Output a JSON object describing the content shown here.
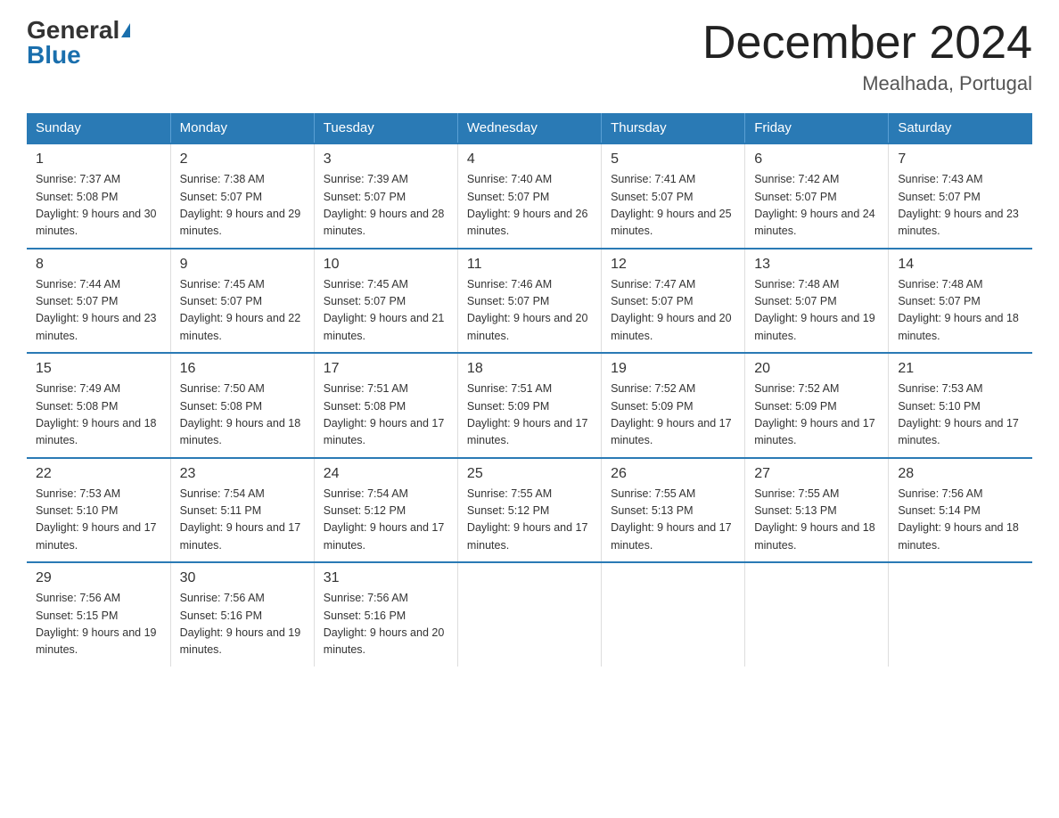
{
  "header": {
    "logo_general": "General",
    "logo_blue": "Blue",
    "title": "December 2024",
    "location": "Mealhada, Portugal"
  },
  "columns": [
    "Sunday",
    "Monday",
    "Tuesday",
    "Wednesday",
    "Thursday",
    "Friday",
    "Saturday"
  ],
  "weeks": [
    [
      {
        "day": "1",
        "sunrise": "7:37 AM",
        "sunset": "5:08 PM",
        "daylight": "9 hours and 30 minutes."
      },
      {
        "day": "2",
        "sunrise": "7:38 AM",
        "sunset": "5:07 PM",
        "daylight": "9 hours and 29 minutes."
      },
      {
        "day": "3",
        "sunrise": "7:39 AM",
        "sunset": "5:07 PM",
        "daylight": "9 hours and 28 minutes."
      },
      {
        "day": "4",
        "sunrise": "7:40 AM",
        "sunset": "5:07 PM",
        "daylight": "9 hours and 26 minutes."
      },
      {
        "day": "5",
        "sunrise": "7:41 AM",
        "sunset": "5:07 PM",
        "daylight": "9 hours and 25 minutes."
      },
      {
        "day": "6",
        "sunrise": "7:42 AM",
        "sunset": "5:07 PM",
        "daylight": "9 hours and 24 minutes."
      },
      {
        "day": "7",
        "sunrise": "7:43 AM",
        "sunset": "5:07 PM",
        "daylight": "9 hours and 23 minutes."
      }
    ],
    [
      {
        "day": "8",
        "sunrise": "7:44 AM",
        "sunset": "5:07 PM",
        "daylight": "9 hours and 23 minutes."
      },
      {
        "day": "9",
        "sunrise": "7:45 AM",
        "sunset": "5:07 PM",
        "daylight": "9 hours and 22 minutes."
      },
      {
        "day": "10",
        "sunrise": "7:45 AM",
        "sunset": "5:07 PM",
        "daylight": "9 hours and 21 minutes."
      },
      {
        "day": "11",
        "sunrise": "7:46 AM",
        "sunset": "5:07 PM",
        "daylight": "9 hours and 20 minutes."
      },
      {
        "day": "12",
        "sunrise": "7:47 AM",
        "sunset": "5:07 PM",
        "daylight": "9 hours and 20 minutes."
      },
      {
        "day": "13",
        "sunrise": "7:48 AM",
        "sunset": "5:07 PM",
        "daylight": "9 hours and 19 minutes."
      },
      {
        "day": "14",
        "sunrise": "7:48 AM",
        "sunset": "5:07 PM",
        "daylight": "9 hours and 18 minutes."
      }
    ],
    [
      {
        "day": "15",
        "sunrise": "7:49 AM",
        "sunset": "5:08 PM",
        "daylight": "9 hours and 18 minutes."
      },
      {
        "day": "16",
        "sunrise": "7:50 AM",
        "sunset": "5:08 PM",
        "daylight": "9 hours and 18 minutes."
      },
      {
        "day": "17",
        "sunrise": "7:51 AM",
        "sunset": "5:08 PM",
        "daylight": "9 hours and 17 minutes."
      },
      {
        "day": "18",
        "sunrise": "7:51 AM",
        "sunset": "5:09 PM",
        "daylight": "9 hours and 17 minutes."
      },
      {
        "day": "19",
        "sunrise": "7:52 AM",
        "sunset": "5:09 PM",
        "daylight": "9 hours and 17 minutes."
      },
      {
        "day": "20",
        "sunrise": "7:52 AM",
        "sunset": "5:09 PM",
        "daylight": "9 hours and 17 minutes."
      },
      {
        "day": "21",
        "sunrise": "7:53 AM",
        "sunset": "5:10 PM",
        "daylight": "9 hours and 17 minutes."
      }
    ],
    [
      {
        "day": "22",
        "sunrise": "7:53 AM",
        "sunset": "5:10 PM",
        "daylight": "9 hours and 17 minutes."
      },
      {
        "day": "23",
        "sunrise": "7:54 AM",
        "sunset": "5:11 PM",
        "daylight": "9 hours and 17 minutes."
      },
      {
        "day": "24",
        "sunrise": "7:54 AM",
        "sunset": "5:12 PM",
        "daylight": "9 hours and 17 minutes."
      },
      {
        "day": "25",
        "sunrise": "7:55 AM",
        "sunset": "5:12 PM",
        "daylight": "9 hours and 17 minutes."
      },
      {
        "day": "26",
        "sunrise": "7:55 AM",
        "sunset": "5:13 PM",
        "daylight": "9 hours and 17 minutes."
      },
      {
        "day": "27",
        "sunrise": "7:55 AM",
        "sunset": "5:13 PM",
        "daylight": "9 hours and 18 minutes."
      },
      {
        "day": "28",
        "sunrise": "7:56 AM",
        "sunset": "5:14 PM",
        "daylight": "9 hours and 18 minutes."
      }
    ],
    [
      {
        "day": "29",
        "sunrise": "7:56 AM",
        "sunset": "5:15 PM",
        "daylight": "9 hours and 19 minutes."
      },
      {
        "day": "30",
        "sunrise": "7:56 AM",
        "sunset": "5:16 PM",
        "daylight": "9 hours and 19 minutes."
      },
      {
        "day": "31",
        "sunrise": "7:56 AM",
        "sunset": "5:16 PM",
        "daylight": "9 hours and 20 minutes."
      },
      null,
      null,
      null,
      null
    ]
  ]
}
